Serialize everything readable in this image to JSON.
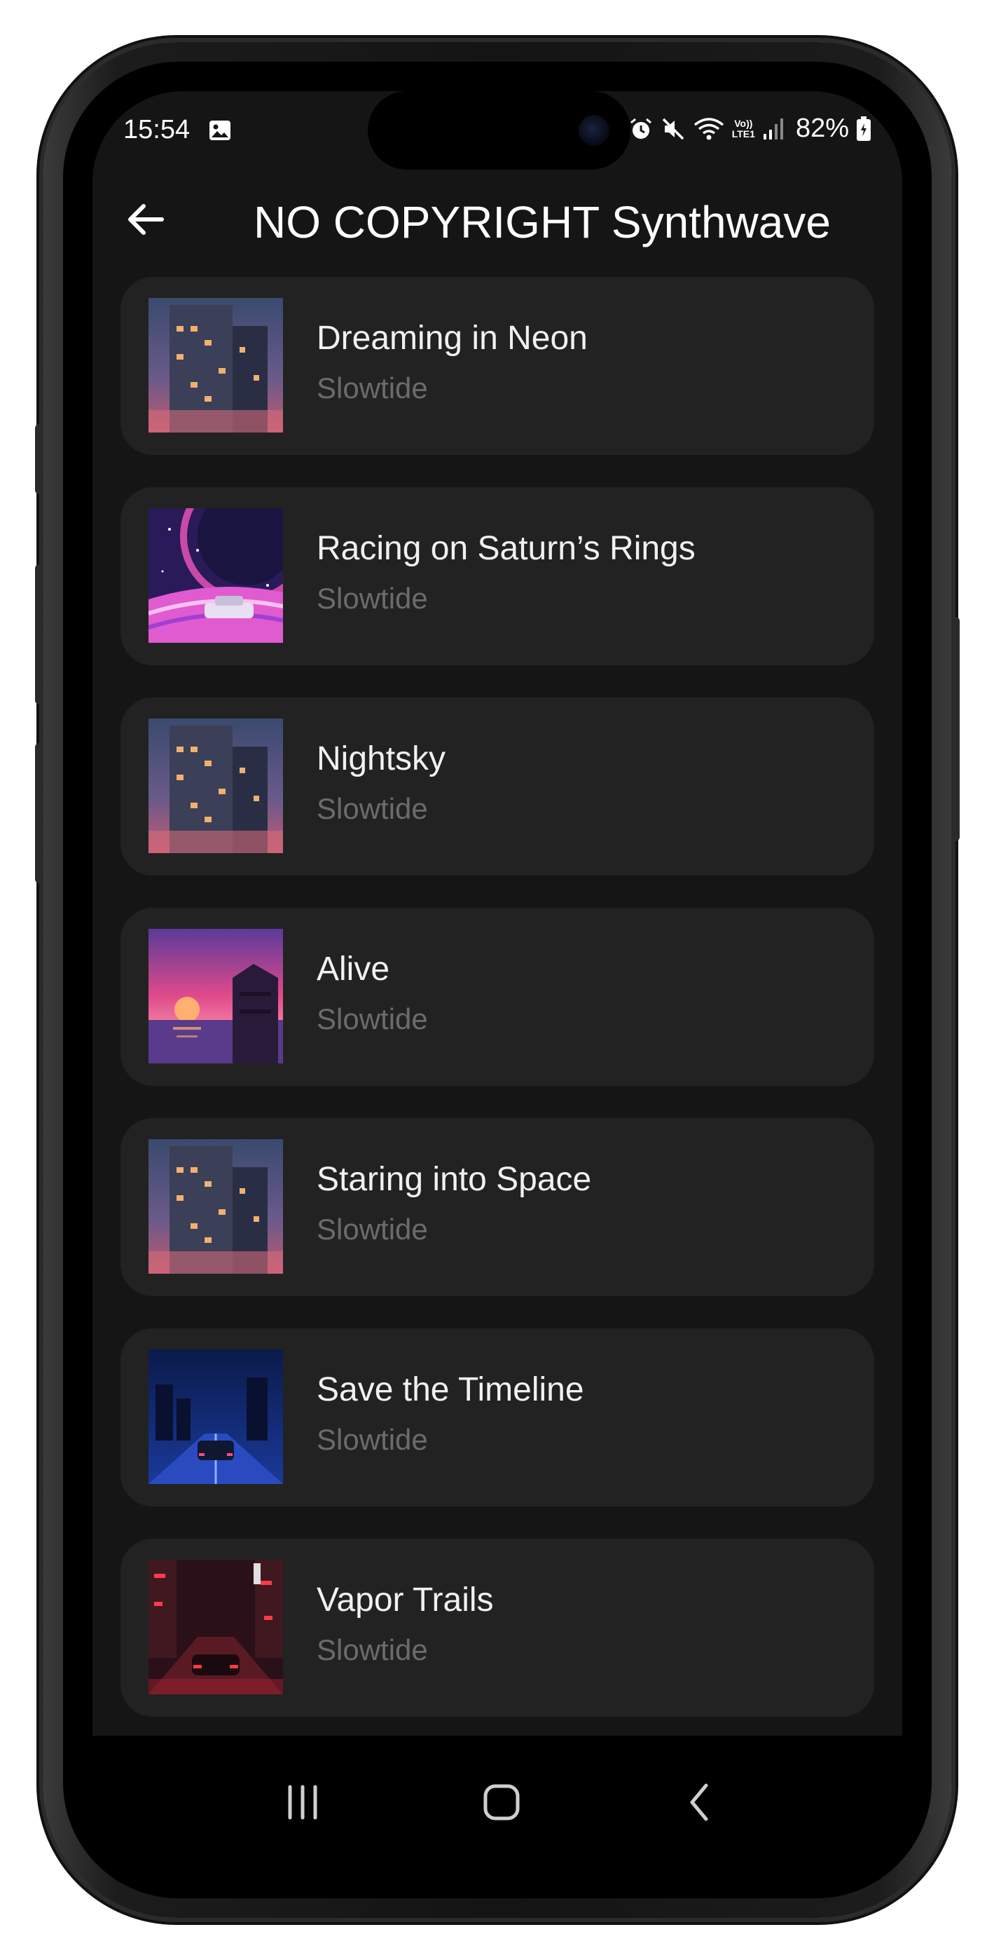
{
  "status_bar": {
    "time": "15:54",
    "battery_percent": "82%",
    "icons": [
      "gallery-icon",
      "alarm-icon",
      "mute-icon",
      "wifi-icon",
      "volte-icon",
      "signal-icon",
      "battery-icon"
    ],
    "volte_label_top": "Vo))",
    "volte_label_bottom": "LTE1"
  },
  "app_bar": {
    "back_icon": "arrow-left-icon",
    "title": "NO COPYRIGHT Synthwave"
  },
  "songs": [
    {
      "title": "Dreaming in Neon",
      "artist": "Slowtide",
      "art": "neon-building"
    },
    {
      "title": "Racing on Saturn’s Rings",
      "artist": "Slowtide",
      "art": "saturn-car"
    },
    {
      "title": "Nightsky",
      "artist": "Slowtide",
      "art": "neon-building"
    },
    {
      "title": "Alive",
      "artist": "Slowtide",
      "art": "sunset-sea"
    },
    {
      "title": "Staring into Space",
      "artist": "Slowtide",
      "art": "neon-building"
    },
    {
      "title": "Save the Timeline",
      "artist": "Slowtide",
      "art": "blue-city-car"
    },
    {
      "title": "Vapor Trails",
      "artist": "Slowtide",
      "art": "red-street-car"
    }
  ],
  "nav_bar": {
    "icons": [
      "recent-apps-icon",
      "home-icon",
      "back-icon"
    ]
  },
  "colors": {
    "screen_bg": "#151515",
    "card_bg": "#222222",
    "title_text": "#f1f1f1",
    "subtitle_text": "#6b6b6b",
    "nav_bg": "#000000"
  }
}
